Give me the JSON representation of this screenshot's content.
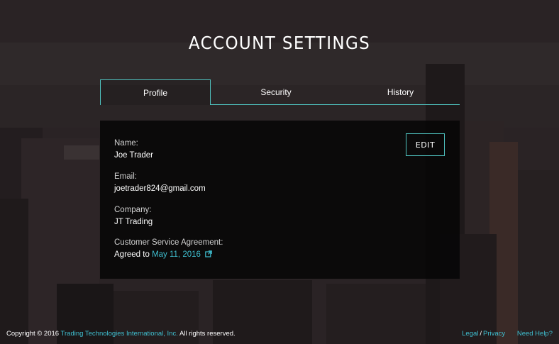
{
  "page": {
    "title": "ACCOUNT SETTINGS"
  },
  "tabs": [
    {
      "label": "Profile",
      "active": true
    },
    {
      "label": "Security",
      "active": false
    },
    {
      "label": "History",
      "active": false
    }
  ],
  "profile": {
    "name_label": "Name:",
    "name_value": "Joe Trader",
    "email_label": "Email:",
    "email_value": "joetrader824@gmail.com",
    "company_label": "Company:",
    "company_value": "JT Trading",
    "csa_label": "Customer Service Agreement:",
    "csa_prefix": "Agreed to",
    "csa_date": "May 11, 2016",
    "edit_label": "EDIT"
  },
  "footer": {
    "copyright_prefix": "Copyright © 2016",
    "company_link": "Trading Technologies International, Inc.",
    "copyright_suffix": "All rights reserved.",
    "legal": "Legal",
    "separator": "/",
    "privacy": "Privacy",
    "help": "Need Help?"
  },
  "colors": {
    "accent": "#4fc3c0",
    "link": "#3fbfd0",
    "panel": "#060606"
  },
  "icons": [
    "external-link-icon"
  ]
}
